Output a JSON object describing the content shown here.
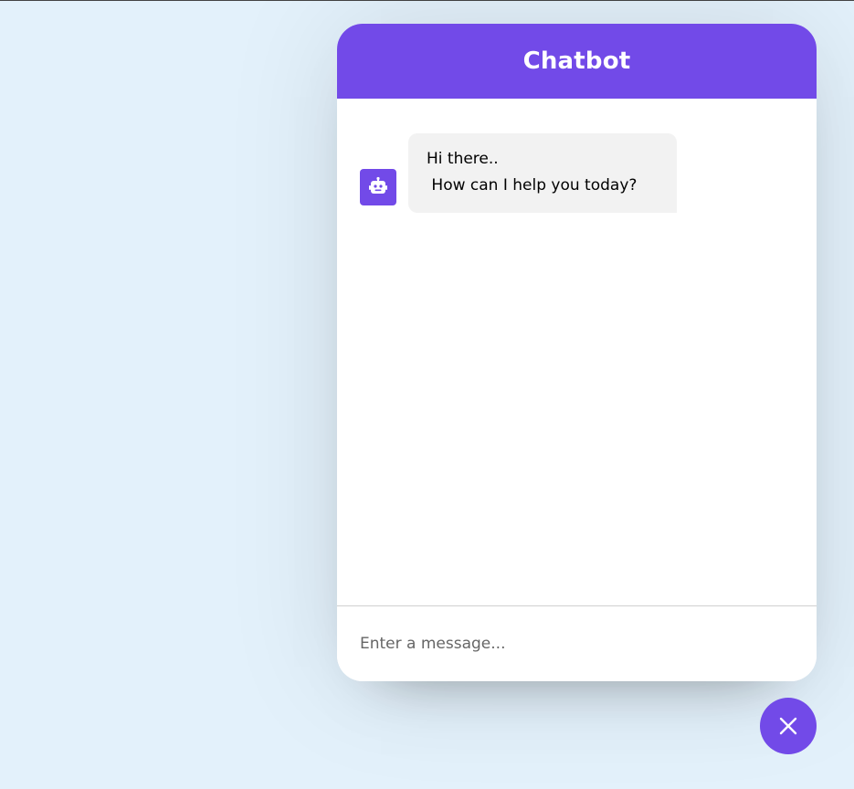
{
  "colors": {
    "accent": "#724ae8",
    "page_background": "#e3f1fb",
    "bubble_background": "#f2f2f2"
  },
  "header": {
    "title": "Chatbot"
  },
  "messages": [
    {
      "sender": "bot",
      "avatar_icon": "robot-icon",
      "text": "Hi there..\n How can I help you today?"
    }
  ],
  "input": {
    "placeholder": "Enter a message...",
    "value": ""
  },
  "toggler": {
    "icon": "close-icon"
  }
}
